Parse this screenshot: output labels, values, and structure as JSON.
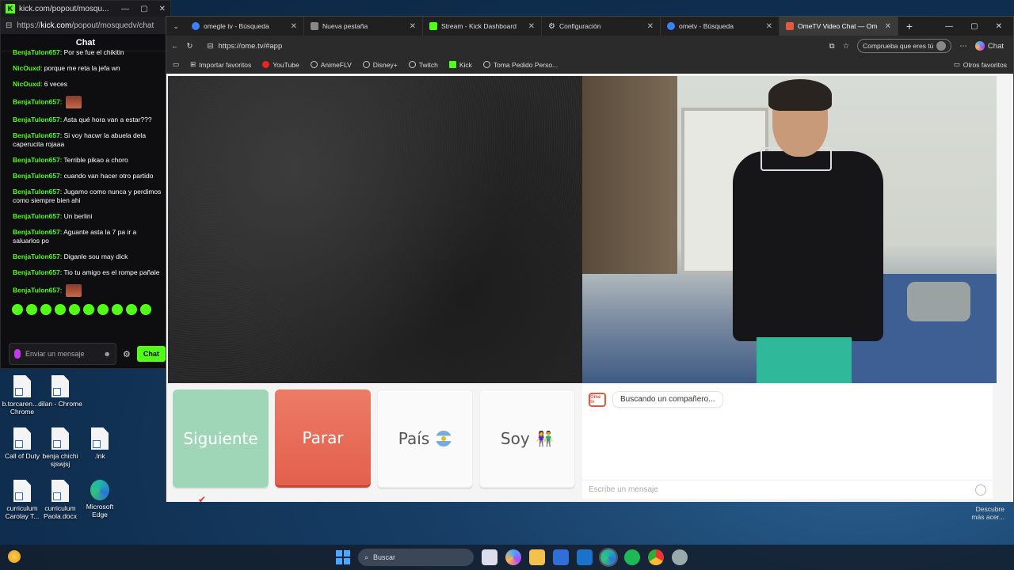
{
  "kick_window": {
    "title": "kick.com/popout/mosqu...",
    "url_prefix": "https://",
    "url_domain": "kick.com",
    "url_path": "/popout/mosquedv/chat",
    "chat_heading": "Chat",
    "messages": [
      {
        "user": "BenjaTulon657",
        "text": "Por se fue el chikitin"
      },
      {
        "user": "NicOuxd",
        "text": "porque me reta la jefa wn"
      },
      {
        "user": "NicOuxd",
        "text": "6 veces"
      },
      {
        "user": "BenjaTulon657",
        "text": ""
      },
      {
        "user": "BenjaTulon657",
        "text": "Asta qué hora van a estar???"
      },
      {
        "user": "BenjaTulon657",
        "text": "Si voy hacwr la abuela dela caperucita rojaaa"
      },
      {
        "user": "BenjaTulon657",
        "text": "Terrible pikao a choro"
      },
      {
        "user": "BenjaTulon657",
        "text": "cuando van hacer otro partido"
      },
      {
        "user": "BenjaTulon657",
        "text": "Jugamo como nunca y perdimos como siempre bien ahi"
      },
      {
        "user": "BenjaTulon657",
        "text": "Un berlini"
      },
      {
        "user": "BenjaTulon657",
        "text": "Aguante asta la 7 pa ir a saluarlos po"
      },
      {
        "user": "BenjaTulon657",
        "text": "Diganle sou may dick"
      },
      {
        "user": "BenjaTulon657",
        "text": "Tio tu amigo es el rompe pañale"
      },
      {
        "user": "BenjaTulon657",
        "text": ""
      }
    ],
    "input_placeholder": "Enviar un mensaje",
    "chat_button": "Chat"
  },
  "desktop_icons": [
    {
      "label": "b.torcaren... - Chrome"
    },
    {
      "label": "dilan - Chrome"
    },
    {
      "label": "Call of Duty"
    },
    {
      "label": "benja chichi sjswjsj"
    },
    {
      "label": ".lnk"
    },
    {
      "label": "curriculum Carolay T..."
    },
    {
      "label": "curriculum Paola.docx"
    },
    {
      "label": "Microsoft Edge"
    }
  ],
  "browser": {
    "tabs": [
      {
        "label": "omegle tv - Búsqueda",
        "color": "#3b82f6"
      },
      {
        "label": "Nueva pestaña",
        "color": "#888888"
      },
      {
        "label": "Stream - Kick Dashboard",
        "color": "#53fc18"
      },
      {
        "label": "Configuración",
        "color": "#cccccc"
      },
      {
        "label": "ometv - Búsqueda",
        "color": "#3b82f6"
      },
      {
        "label": "OmeTV Video Chat — Om",
        "color": "#e4583e"
      }
    ],
    "address": "https://ome.tv/#app",
    "profile_button": "Comprueba que eres tú",
    "copilot_label": "Chat",
    "bookmarks": [
      {
        "label": "Importar favoritos"
      },
      {
        "label": "YouTube"
      },
      {
        "label": "AnimeFLV"
      },
      {
        "label": "Disney+"
      },
      {
        "label": "Twitch"
      },
      {
        "label": "Kick"
      },
      {
        "label": "Toma Pedido Perso..."
      }
    ],
    "other_favorites": "Otros favoritos"
  },
  "ometv": {
    "buttons": {
      "next": "Siguiente",
      "stop": "Parar",
      "country": "País",
      "gender": "Soy"
    },
    "status_message": "Buscando un compañero...",
    "logo_text": "Ome tv",
    "message_placeholder": "Escribe un mensaje"
  },
  "taskbar": {
    "search_placeholder": "Buscar",
    "corner_text_line1": "Descubre",
    "corner_text_line2": "más acer..."
  }
}
